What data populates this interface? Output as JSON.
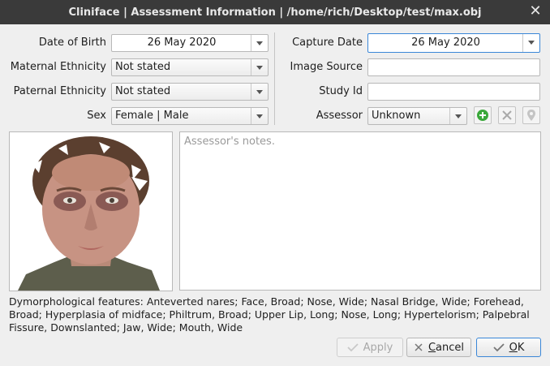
{
  "window": {
    "title": "Cliniface | Assessment Information | /home/rich/Desktop/test/max.obj",
    "close_icon": "close-icon"
  },
  "left_form": {
    "dob_label": "Date of Birth",
    "dob_value": "26 May 2020",
    "maternal_label": "Maternal Ethnicity",
    "maternal_value": "Not stated",
    "paternal_label": "Paternal Ethnicity",
    "paternal_value": "Not stated",
    "sex_label": "Sex",
    "sex_value": "Female | Male"
  },
  "right_form": {
    "capture_label": "Capture Date",
    "capture_value": "26 May 2020",
    "source_label": "Image Source",
    "source_value": "",
    "study_label": "Study Id",
    "study_value": "",
    "assessor_label": "Assessor",
    "assessor_value": "Unknown",
    "add_icon": "plus-circle-icon",
    "remove_icon": "x-icon",
    "location_icon": "pin-icon"
  },
  "notes": {
    "placeholder": "Assessor's notes."
  },
  "features_text": "Dymorphological features: Anteverted nares; Face, Broad; Nose, Wide; Nasal Bridge, Wide; Forehead, Broad; Hyperplasia of midface; Philtrum, Broad; Upper Lip, Long; Nose, Long; Hypertelorism; Palpebral Fissure, Downslanted; Jaw, Wide; Mouth, Wide",
  "buttons": {
    "apply": {
      "mnemonic": "",
      "rest": "Apply"
    },
    "cancel": {
      "mnemonic": "C",
      "rest": "ancel"
    },
    "ok": {
      "mnemonic": "O",
      "rest": "K"
    }
  },
  "colors": {
    "accent": "#3a87d8",
    "titlebar": "#3a3a3a",
    "add_green": "#3aa83a"
  }
}
